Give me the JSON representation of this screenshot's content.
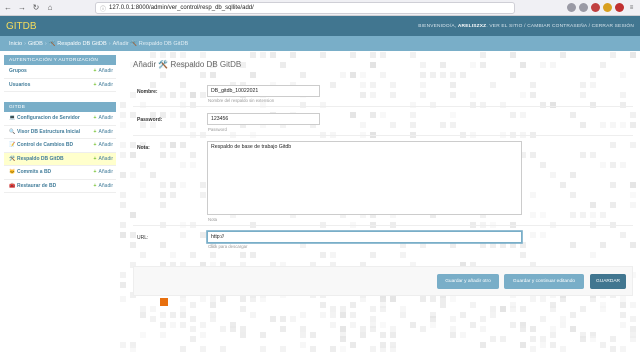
{
  "browser": {
    "url": "127.0.0.1:8000/admin/ver_control/resp_db_sqllite/add/"
  },
  "header": {
    "brand": "GITDB",
    "welcome": "BIENVENIDO/A,",
    "username": "ARELISZXZ",
    "links": [
      "VER EL SITIO",
      "CAMBIAR CONTRASEÑA",
      "CERRAR SESIÓN"
    ],
    "separator": "/"
  },
  "breadcrumbs": {
    "items": [
      "Inicio",
      "GitDB",
      "🛠️ Respaldo DB GitDB",
      "Añadir 🛠️ Respaldo DB GitDB"
    ],
    "separator": "›"
  },
  "sidebar": {
    "modules": [
      {
        "caption": "AUTENTICACIÓN Y AUTORIZACIÓN",
        "rows": [
          {
            "label": "Grupos",
            "add": "Añadir",
            "icon": ""
          },
          {
            "label": "Usuarios",
            "add": "Añadir",
            "icon": ""
          }
        ]
      },
      {
        "caption": "GITDB",
        "rows": [
          {
            "label": "Configuracion de Servidor",
            "add": "Añadir",
            "icon": "💻"
          },
          {
            "label": "Visor DB Estructura Inicial",
            "add": "Añadir",
            "icon": "🔍"
          },
          {
            "label": "Control de Cambios BD",
            "add": "Añadir",
            "icon": "📝"
          },
          {
            "label": "Respaldo DB GitDB",
            "add": "Añadir",
            "icon": "🛠️",
            "selected": true
          },
          {
            "label": "Commits a BD",
            "add": "Añadir",
            "icon": "🐱"
          },
          {
            "label": "Restaurar de BD",
            "add": "Añadir",
            "icon": "🧰"
          }
        ]
      }
    ],
    "add_plus": "+"
  },
  "main": {
    "title": "Añadir 🛠️ Respaldo DB GitDB",
    "fields": {
      "nombre": {
        "label": "Nombre:",
        "value": "DB_gitdb_10022021",
        "help": "Nombre del respaldo sin extension"
      },
      "password": {
        "label": "Password:",
        "value": "123456",
        "help": "Password"
      },
      "nota": {
        "label": "Nota:",
        "value": "Respaldo de base de trabajo Gitdb",
        "help": "Nota"
      },
      "url": {
        "label": "URL:",
        "value": "http://",
        "help": "Click para descargar"
      }
    },
    "buttons": {
      "save_add": "Guardar y añadir otro",
      "save_continue": "Guardar y continuar editando",
      "save": "GUARDAR"
    }
  },
  "colors": {
    "header": "#417690",
    "breadcrumbs": "#79aec8",
    "brand": "#f5dd5d",
    "accent_orange": "#e8700f"
  }
}
